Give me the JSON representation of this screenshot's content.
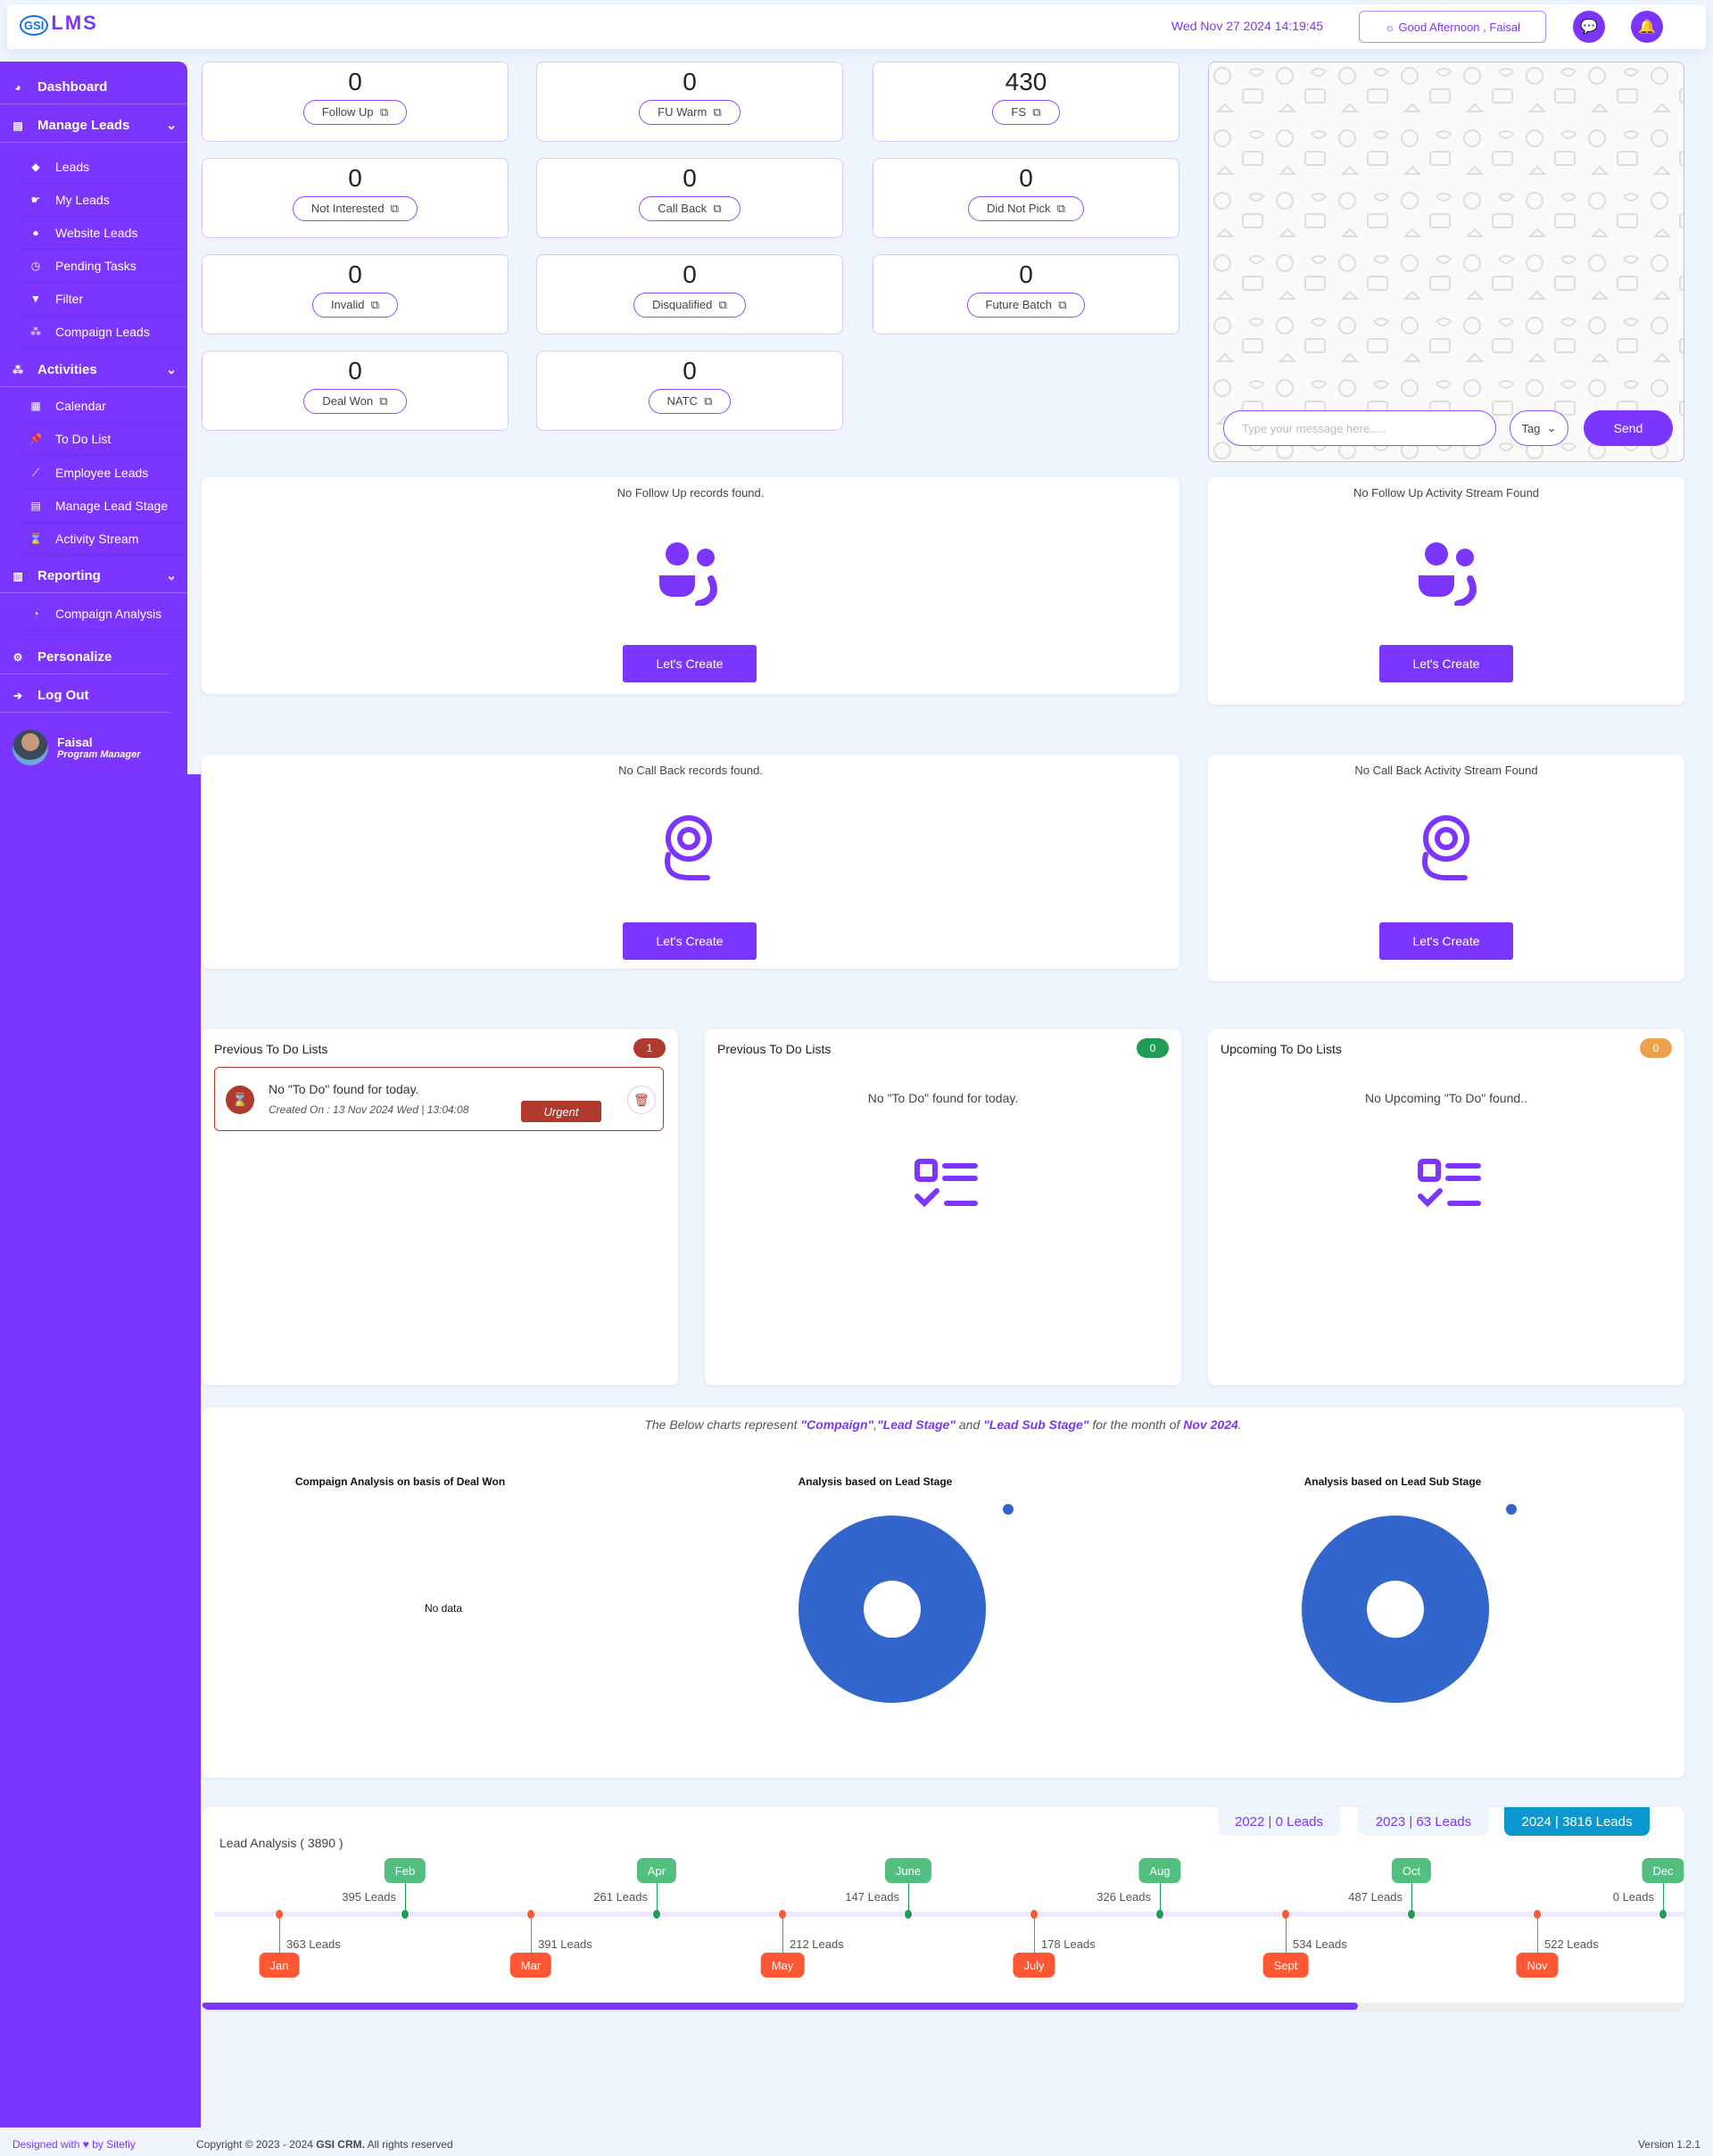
{
  "header": {
    "logo": "GSI LMS",
    "datetime": "Wed Nov 27 2024 14:19:45",
    "greeting": "Good Afternoon , Faisal"
  },
  "sidebar": {
    "dashboard": "Dashboard",
    "manage_leads": "Manage Leads",
    "manage_items": [
      "Leads",
      "My Leads",
      "Website Leads",
      "Pending Tasks",
      "Filter",
      "Compaign Leads"
    ],
    "activities": "Activities",
    "activity_items": [
      "Calendar",
      "To Do List",
      "Employee Leads",
      "Manage Lead Stage",
      "Activity Stream"
    ],
    "reporting": "Reporting",
    "reporting_items": [
      "Compaign Analysis"
    ],
    "personalize": "Personalize",
    "logout": "Log Out",
    "user": {
      "name": "Faisal",
      "role": "Program Manager"
    }
  },
  "stats": [
    {
      "value": "0",
      "label": "Follow Up"
    },
    {
      "value": "0",
      "label": "FU Warm"
    },
    {
      "value": "430",
      "label": "FS"
    },
    {
      "value": "0",
      "label": "Not Interested"
    },
    {
      "value": "0",
      "label": "Call Back"
    },
    {
      "value": "0",
      "label": "Did Not Pick"
    },
    {
      "value": "0",
      "label": "Invalid"
    },
    {
      "value": "0",
      "label": "Disqualified"
    },
    {
      "value": "0",
      "label": "Future Batch"
    },
    {
      "value": "0",
      "label": "Deal Won"
    },
    {
      "value": "0",
      "label": "NATC"
    }
  ],
  "chat": {
    "placeholder": "Type your message here.....",
    "tag": "Tag",
    "send": "Send"
  },
  "empty": {
    "followup": "No Follow Up records found.",
    "followup_stream": "No Follow Up Activity Stream Found",
    "callback": "No Call Back records found.",
    "callback_stream": "No Call Back Activity Stream Found",
    "create": "Let's Create"
  },
  "todo": [
    {
      "title": "Previous To Do Lists",
      "count": "1",
      "color": "#b03a2e",
      "item": {
        "text": "No \"To Do\" found for today.",
        "created": "Created On : 13 Nov 2024 Wed | 13:04:08",
        "priority": "Urgent"
      }
    },
    {
      "title": "Previous To Do Lists",
      "count": "0",
      "color": "#1e9e55",
      "message": "No \"To Do\" found for today."
    },
    {
      "title": "Upcoming To Do Lists",
      "count": "0",
      "color": "#eba24a",
      "message": "No Upcoming \"To Do\" found.."
    }
  ],
  "charts_caption": {
    "pre": "The Below charts represent ",
    "c1": "\"Compaign\"",
    "sep": ",",
    "c2": "\"Lead Stage\"",
    "and": " and ",
    "c3": "\"Lead Sub Stage\"",
    "post": " for the month of ",
    "month": "Nov 2024",
    "end": "."
  },
  "chart_data": [
    {
      "type": "pie",
      "title": "Compaign Analysis on basis of Deal Won",
      "values": [],
      "no_data": "No data"
    },
    {
      "type": "pie",
      "title": "Analysis based on Lead Stage",
      "values": [
        100
      ],
      "colors": [
        "#3366cc"
      ],
      "donut": true
    },
    {
      "type": "pie",
      "title": "Analysis based on Lead Sub Stage",
      "values": [
        100
      ],
      "colors": [
        "#3366cc"
      ],
      "donut": true
    }
  ],
  "lead_analysis": {
    "title": "Lead Analysis ( 3890 )",
    "years": [
      {
        "label": "2022 | 0 Leads"
      },
      {
        "label": "2023 | 63 Leads"
      },
      {
        "label": "2024 | 3816 Leads",
        "active": true
      }
    ],
    "months": [
      {
        "m": "Jan",
        "leads": "363 Leads"
      },
      {
        "m": "Feb",
        "leads": "395 Leads"
      },
      {
        "m": "Mar",
        "leads": "391 Leads"
      },
      {
        "m": "Apr",
        "leads": "261 Leads"
      },
      {
        "m": "May",
        "leads": "212 Leads"
      },
      {
        "m": "June",
        "leads": "147 Leads"
      },
      {
        "m": "July",
        "leads": "178 Leads"
      },
      {
        "m": "Aug",
        "leads": "326 Leads"
      },
      {
        "m": "Sept",
        "leads": "534 Leads"
      },
      {
        "m": "Oct",
        "leads": "487 Leads"
      },
      {
        "m": "Nov",
        "leads": "522 Leads"
      },
      {
        "m": "Dec",
        "leads": "0 Leads"
      }
    ],
    "scroll_progress": 0.78
  },
  "footer": {
    "designed": "Designed with",
    "by": "by Sitefiy",
    "copyright_pre": "Copyright © 2023 - 2024 ",
    "brand": "GSI CRM.",
    "copyright_post": " All rights reserved",
    "version": "Version 1.2.1"
  },
  "colors": {
    "accent": "#7b35ff",
    "green": "#52be80",
    "orange": "#ff5733",
    "pie": "#3366cc"
  }
}
